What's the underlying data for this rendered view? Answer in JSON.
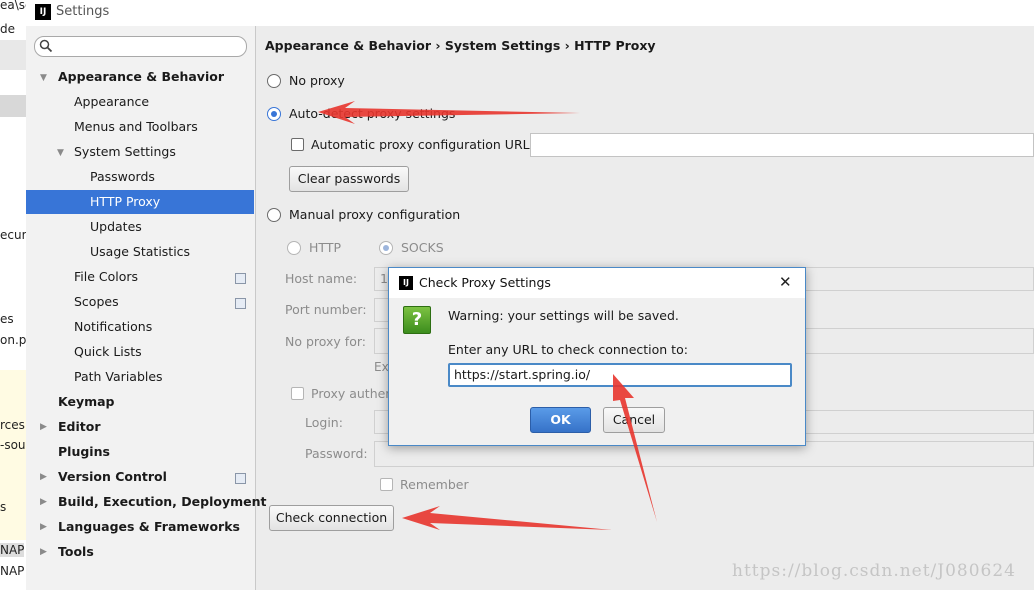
{
  "window": {
    "title": "Settings",
    "app_icon": "IJ"
  },
  "background_app": {
    "fragments": [
      "ea\\se",
      "de",
      "ecuri",
      "es",
      "on.p",
      "rces",
      "-sou",
      "s",
      "NAP",
      "NAP"
    ]
  },
  "sidebar": {
    "search_placeholder": "",
    "items": [
      {
        "label": "Appearance & Behavior",
        "bold": true
      },
      {
        "label": "Appearance"
      },
      {
        "label": "Menus and Toolbars"
      },
      {
        "label": "System Settings"
      },
      {
        "label": "Passwords"
      },
      {
        "label": "HTTP Proxy",
        "selected": true
      },
      {
        "label": "Updates"
      },
      {
        "label": "Usage Statistics"
      },
      {
        "label": "File Colors"
      },
      {
        "label": "Scopes"
      },
      {
        "label": "Notifications"
      },
      {
        "label": "Quick Lists"
      },
      {
        "label": "Path Variables"
      },
      {
        "label": "Keymap",
        "bold": true
      },
      {
        "label": "Editor",
        "bold": true
      },
      {
        "label": "Plugins",
        "bold": true
      },
      {
        "label": "Version Control",
        "bold": true
      },
      {
        "label": "Build, Execution, Deployment",
        "bold": true
      },
      {
        "label": "Languages & Frameworks",
        "bold": true
      },
      {
        "label": "Tools",
        "bold": true
      }
    ]
  },
  "content": {
    "breadcrumb": "Appearance & Behavior › System Settings › HTTP Proxy",
    "no_proxy": "No proxy",
    "auto_detect": "Auto-detect proxy settings",
    "auto_config_url": "Automatic proxy configuration URL:",
    "clear_passwords": "Clear passwords",
    "manual": "Manual proxy configuration",
    "http": "HTTP",
    "socks": "SOCKS",
    "host_name": "Host name:",
    "host_value": "1",
    "port_number": "Port number:",
    "no_proxy_for": "No proxy for:",
    "example_prefix": "Ex",
    "proxy_auth": "Proxy authent",
    "login": "Login:",
    "password": "Password:",
    "remember": "Remember",
    "check_connection": "Check connection"
  },
  "dialog": {
    "title": "Check Proxy Settings",
    "close": "✕",
    "question_glyph": "?",
    "warning": "Warning: your settings will be saved.",
    "prompt": "Enter any URL to check connection to:",
    "url": "https://start.spring.io/",
    "ok": "OK",
    "cancel": "Cancel"
  },
  "watermark": "https://blog.csdn.net/J080624",
  "colors": {
    "selection": "#3875d7",
    "arrow": "#e8352e"
  }
}
